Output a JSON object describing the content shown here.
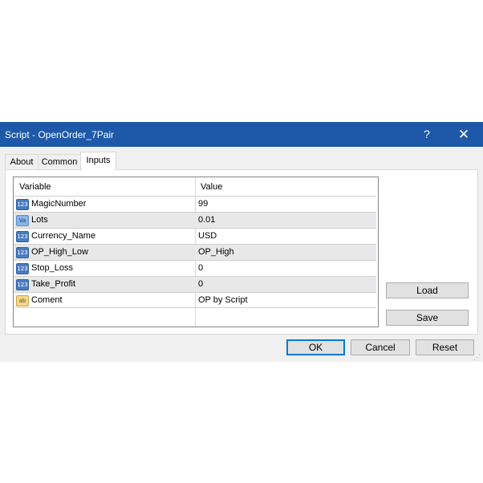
{
  "window": {
    "title": "Script - OpenOrder_7Pair",
    "help_glyph": "?",
    "close_glyph": "✕"
  },
  "tabs": [
    {
      "label": "About"
    },
    {
      "label": "Common"
    },
    {
      "label": "Inputs"
    }
  ],
  "grid": {
    "columns": [
      "Variable",
      "Value"
    ],
    "rows": [
      {
        "icon": "123",
        "type_icon": "integer-type-icon",
        "variable": "MagicNumber",
        "value": "99"
      },
      {
        "icon": "Va",
        "type_icon": "double-type-icon",
        "variable": "Lots",
        "value": "0.01"
      },
      {
        "icon": "123",
        "type_icon": "integer-type-icon",
        "variable": "Currency_Name",
        "value": "USD"
      },
      {
        "icon": "123",
        "type_icon": "integer-type-icon",
        "variable": "OP_High_Low",
        "value": "OP_High"
      },
      {
        "icon": "123",
        "type_icon": "integer-type-icon",
        "variable": "Stop_Loss",
        "value": "0"
      },
      {
        "icon": "123",
        "type_icon": "integer-type-icon",
        "variable": "Take_Profit",
        "value": "0"
      },
      {
        "icon": "ab",
        "type_icon": "string-type-icon",
        "variable": "Coment",
        "value": "OP by Script"
      }
    ]
  },
  "side_buttons": {
    "load": "Load",
    "save": "Save"
  },
  "footer_buttons": {
    "ok": "OK",
    "cancel": "Cancel",
    "reset": "Reset"
  },
  "colors": {
    "titlebar": "#1e58a8",
    "dialog_bg": "#f0f0f0",
    "alt_row": "#e8e8e8",
    "default_border": "#0078d7"
  }
}
